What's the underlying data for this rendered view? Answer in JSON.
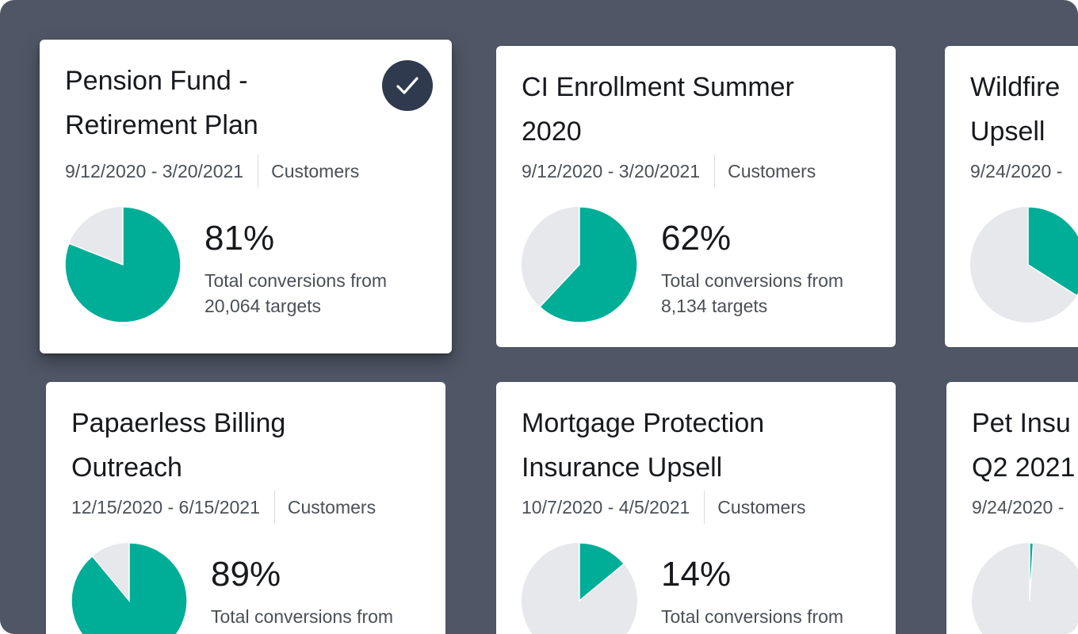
{
  "colors": {
    "background": "#4f5766",
    "card": "#ffffff",
    "accent": "#00ad97",
    "pie_rest": "#e6e8eb",
    "check_bg": "#2f3a4e"
  },
  "cards": [
    {
      "title": "Pension Fund - Retirement Plan",
      "dates": "9/12/2020 - 3/20/2021",
      "audience": "Customers",
      "percent_label": "81%",
      "percent": 81,
      "desc_line1": "Total conversions from",
      "desc_line2": "20,064 targets",
      "selected": true,
      "selected_icon": "check-icon"
    },
    {
      "title": "CI Enrollment Summer 2020",
      "dates": "9/12/2020 - 3/20/2021",
      "audience": "Customers",
      "percent_label": "62%",
      "percent": 62,
      "desc_line1": "Total conversions from",
      "desc_line2": "8,134 targets",
      "selected": false
    },
    {
      "title": "Wildfire Upsell",
      "dates": "9/24/2020 -",
      "audience": "",
      "percent_label": "",
      "percent": 34,
      "desc_line1": "",
      "desc_line2": "",
      "selected": false
    },
    {
      "title": "Papaerless Billing Outreach",
      "dates": "12/15/2020 - 6/15/2021",
      "audience": "Customers",
      "percent_label": "89%",
      "percent": 89,
      "desc_line1": "Total conversions from",
      "desc_line2": "",
      "selected": false
    },
    {
      "title": "Mortgage Protection Insurance Upsell",
      "dates": "10/7/2020 - 4/5/2021",
      "audience": "Customers",
      "percent_label": "14%",
      "percent": 14,
      "desc_line1": "Total conversions from",
      "desc_line2": "",
      "selected": false
    },
    {
      "title": "Pet Insu Q2 2021",
      "dates": "9/24/2020 -",
      "audience": "",
      "percent_label": "",
      "percent": 1,
      "desc_line1": "",
      "desc_line2": "",
      "selected": false
    }
  ]
}
